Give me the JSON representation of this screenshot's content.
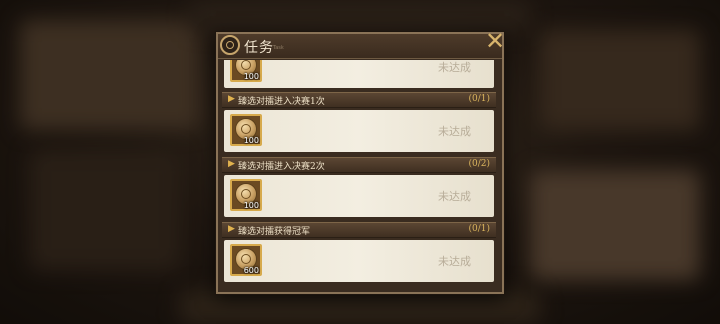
{
  "panel": {
    "title": "任务",
    "subtitle": "Task",
    "close_symbol": "✕"
  },
  "tasks": [
    {
      "name": "",
      "progress": "",
      "reward_amount": "100",
      "status": "未达成",
      "reward_icon": "coin-icon"
    },
    {
      "name": "臻选对擂进入决赛1次",
      "progress": "(0/1)",
      "reward_amount": "100",
      "status": "未达成",
      "reward_icon": "coin-icon"
    },
    {
      "name": "臻选对擂进入决赛2次",
      "progress": "(0/2)",
      "reward_amount": "100",
      "status": "未达成",
      "reward_icon": "coin-icon"
    },
    {
      "name": "臻选对擂获得冠军",
      "progress": "(0/1)",
      "reward_amount": "600",
      "status": "未达成",
      "reward_icon": "coin-icon"
    }
  ],
  "colors": {
    "header_bar": "#4e3b2a",
    "progress_text": "#d9b35c",
    "status_text": "#b8ad99",
    "row_bg": "#f3eee1",
    "reward_border": "#d7aa4c"
  }
}
